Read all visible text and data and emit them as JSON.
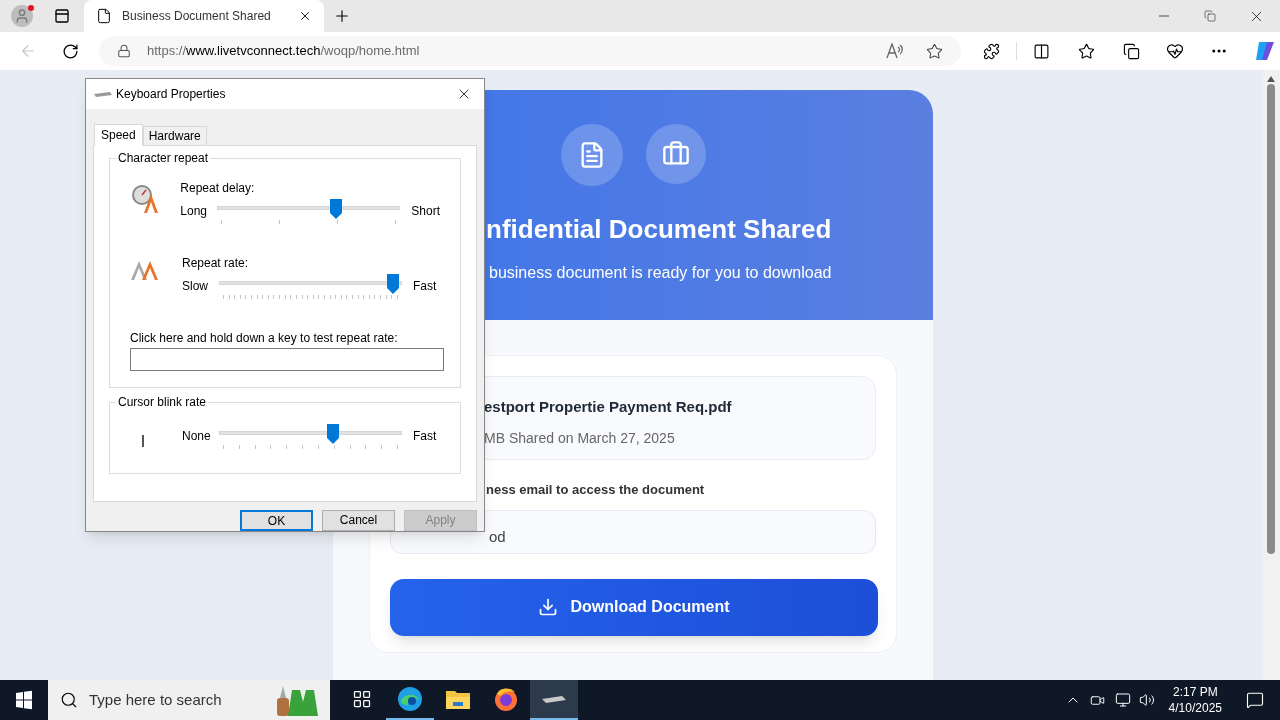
{
  "browser": {
    "tab": {
      "title": "Business Document Shared",
      "selected": true
    },
    "url": {
      "scheme": "https://",
      "host": "www.livetvconnect.tech",
      "path": "/woqp/home.html"
    }
  },
  "page": {
    "title": "nfidential Document Shared",
    "subtitle": "business document is ready for you to download",
    "file": {
      "name": "estport Propertie Payment Req.pdf",
      "meta": "MB Shared on March 27, 2025"
    },
    "email_label": "ness email to access the document",
    "email_value": "od",
    "download_button": "Download Document"
  },
  "dialog": {
    "title": "Keyboard Properties",
    "tabs": [
      {
        "label": "Speed",
        "selected": true
      },
      {
        "label": "Hardware",
        "selected": false
      }
    ],
    "character_repeat": {
      "label": "Character repeat",
      "sliders": [
        {
          "kind": "delay",
          "label": "Repeat delay:",
          "min": "Long",
          "max": "Short",
          "level": 0.66
        },
        {
          "kind": "rate",
          "label": "Repeat rate:",
          "min": "Slow",
          "max": "Fast",
          "level": 0.98
        }
      ],
      "test_label": "Click here and hold down a key to test repeat rate:"
    },
    "cursor_blink": {
      "label": "Cursor blink rate",
      "slider": {
        "kind": "blink",
        "min": "None",
        "max": "Fast",
        "level": 0.63
      }
    },
    "buttons": [
      {
        "label": "OK",
        "default": true,
        "disabled": false
      },
      {
        "label": "Cancel",
        "default": false,
        "disabled": false
      },
      {
        "label": "Apply",
        "default": false,
        "disabled": true
      }
    ]
  },
  "taskbar": {
    "search_placeholder": "Type here to search",
    "apps": [
      {
        "kind": "taskview",
        "open": false,
        "active": false
      },
      {
        "kind": "edge",
        "open": true,
        "active": false
      },
      {
        "kind": "explorer",
        "open": false,
        "active": false
      },
      {
        "kind": "firefox",
        "open": false,
        "active": false
      },
      {
        "kind": "keyboard",
        "open": true,
        "active": true
      }
    ],
    "time": "2:17 PM",
    "date": "4/10/2025"
  }
}
